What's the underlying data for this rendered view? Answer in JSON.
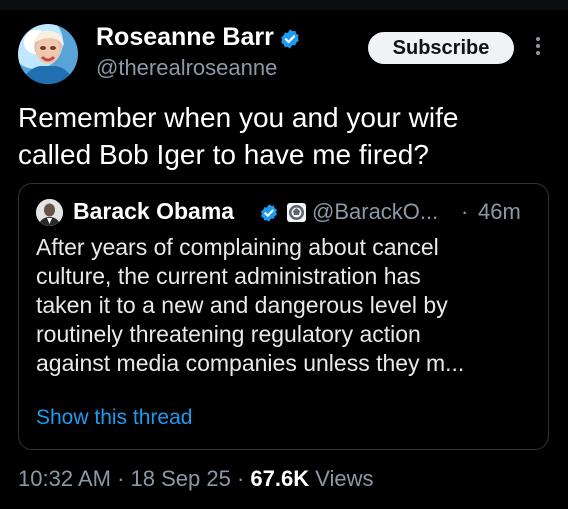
{
  "author": {
    "name": "Roseanne Barr",
    "handle": "@therealroseanne",
    "subscribe_label": "Subscribe"
  },
  "tweet": {
    "text": "Remember when you and your wife\ncalled Bob Iger to have me fired?"
  },
  "quote": {
    "name": "Barack Obama",
    "handle": "@BarackO...",
    "separator": "·",
    "time": "46m",
    "text": "After years of complaining about cancel\nculture, the current administration has\ntaken it to a new and dangerous level by\nroutinely threatening regulatory action\nagainst media companies unless they m...",
    "show_thread": "Show this thread"
  },
  "meta": {
    "time": "10:32 AM",
    "sep1": "·",
    "date": "18 Sep 25",
    "sep2": "·",
    "views_count": "67.6K",
    "views_label": "Views"
  },
  "icons": {
    "verified": "verified-badge-icon",
    "government": "government-seal-icon",
    "more": "more-options-icon"
  },
  "colors": {
    "background": "#000000",
    "text": "#e7e9ea",
    "secondary": "#8b98a5",
    "link": "#1d9bf0",
    "verified": "#1d9bf0",
    "border": "#2f3336"
  }
}
